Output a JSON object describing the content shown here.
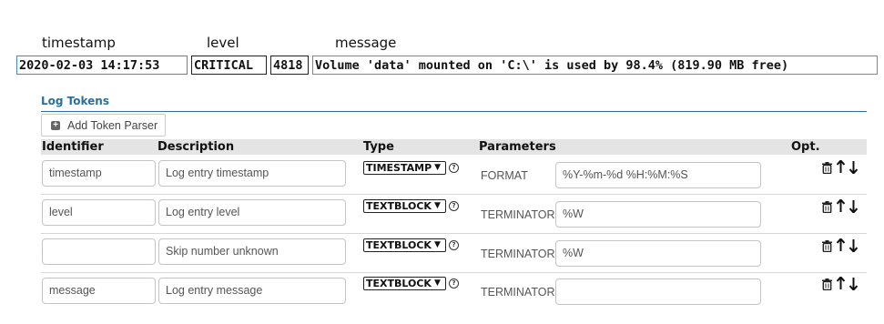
{
  "preview": {
    "labels": {
      "timestamp": "timestamp",
      "level": "level",
      "message": "message"
    },
    "tokens": {
      "timestamp": "2020-02-03 14:17:53",
      "level": "CRITICAL",
      "number": "4818",
      "message": "Volume 'data' mounted on 'C:\\' is used by 98.4% (819.90 MB free)"
    }
  },
  "section": {
    "title": "Log Tokens",
    "add_button": "Add Token Parser"
  },
  "table": {
    "headers": {
      "identifier": "Identifier",
      "description": "Description",
      "type": "Type",
      "parameters": "Parameters",
      "opt": "Opt."
    },
    "rows": [
      {
        "identifier": "timestamp",
        "description": "Log entry timestamp",
        "type": "TIMESTAMP",
        "param_label": "FORMAT",
        "param_value": "%Y-%m-%d %H:%M:%S"
      },
      {
        "identifier": "level",
        "description": "Log entry level",
        "type": "TEXTBLOCK",
        "param_label": "TERMINATORS",
        "param_value": "%W"
      },
      {
        "identifier": "",
        "description": "Skip number unknown",
        "type": "TEXTBLOCK",
        "param_label": "TERMINATORS",
        "param_value": "%W"
      },
      {
        "identifier": "message",
        "description": "Log entry message",
        "type": "TEXTBLOCK",
        "param_label": "TERMINATORS",
        "param_value": ""
      }
    ]
  },
  "colors": {
    "accent": "#2a6fa0",
    "timestamp_border": "#4a8aa6",
    "message_border": "#d46a3a"
  },
  "icons": {
    "add": "plus-square-icon",
    "help": "question-circle-icon",
    "delete": "trash-icon",
    "move_up": "arrow-up-icon",
    "move_down": "arrow-down-icon"
  }
}
